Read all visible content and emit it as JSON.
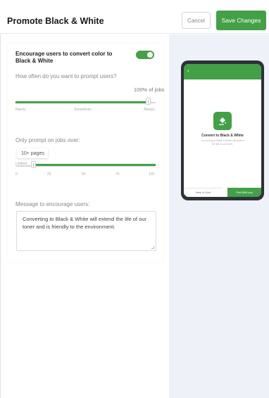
{
  "header": {
    "title": "Promote Black & White",
    "cancel_label": "Cancel",
    "save_label": "Save Changes"
  },
  "settings": {
    "toggle_label": "Encourage users to convert color to Black & White",
    "toggle_on": true,
    "frequency": {
      "question": "How often do you want to prompt users?",
      "value_label": "100% of jobs",
      "value_percent": 100,
      "ticks": [
        "Rarely",
        "Sometimes",
        "Always"
      ]
    },
    "min_pages": {
      "question": "Only prompt on jobs over:",
      "value_label": "10+ pages",
      "min_label": "Limited",
      "ticks": [
        "0",
        "25",
        "50",
        "75",
        "100"
      ]
    },
    "message": {
      "label": "Message to encourage users:",
      "text": "Converting to Black & White will extend the life of our toner and is friendly to the environment."
    }
  },
  "preview": {
    "back_icon": "chevron-left-icon",
    "icon": "paint-bucket-icon",
    "title": "Convert to Black & White",
    "description": "Converting to Black & White will extend the life of our toner.",
    "left_button": "Keep in Color",
    "right_button": "Print B&W only"
  },
  "colors": {
    "accent": "#43a047",
    "phone_body": "#2d3238",
    "preview_bg": "#eef2f8"
  }
}
